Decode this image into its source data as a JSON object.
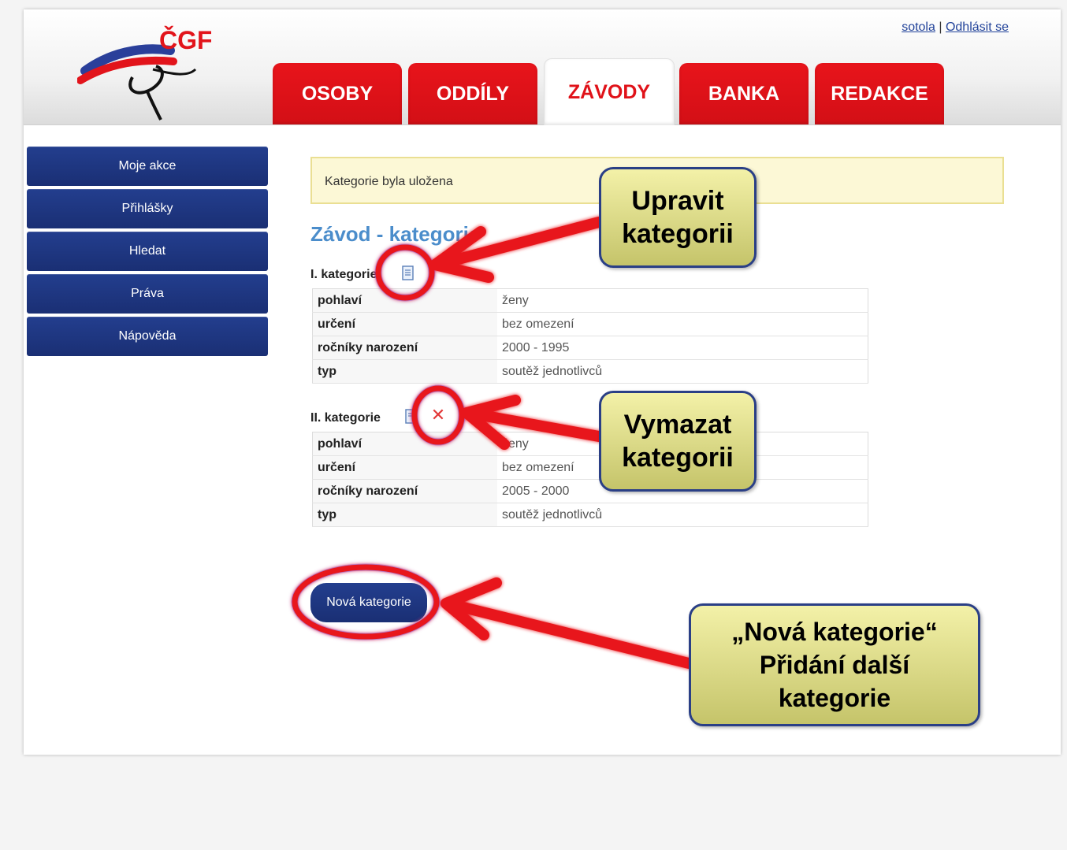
{
  "header": {
    "logo_text": "ČGF",
    "user": "sotola",
    "separator": "|",
    "logout": "Odhlásit se",
    "tabs": [
      {
        "label": "OSOBY",
        "active": false
      },
      {
        "label": "ODDÍLY",
        "active": false
      },
      {
        "label": "ZÁVODY",
        "active": true
      },
      {
        "label": "BANKA",
        "active": false
      },
      {
        "label": "REDAKCE",
        "active": false
      }
    ]
  },
  "sidebar": {
    "items": [
      {
        "label": "Moje akce"
      },
      {
        "label": "Přihlášky"
      },
      {
        "label": "Hledat"
      },
      {
        "label": "Práva"
      },
      {
        "label": "Nápověda"
      }
    ]
  },
  "main": {
    "notice": "Kategorie byla uložena",
    "title": "Závod - kategorie",
    "categories": [
      {
        "heading": "I. kategorie",
        "rows": [
          {
            "label": "pohlaví",
            "value": "ženy"
          },
          {
            "label": "určení",
            "value": "bez omezení"
          },
          {
            "label": "ročníky narození",
            "value": "2000 - 1995"
          },
          {
            "label": "typ",
            "value": "soutěž jednotlivců"
          }
        ]
      },
      {
        "heading": "II. kategorie",
        "rows": [
          {
            "label": "pohlaví",
            "value": "ženy"
          },
          {
            "label": "určení",
            "value": "bez omezení"
          },
          {
            "label": "ročníky narození",
            "value": "2005 - 2000"
          },
          {
            "label": "typ",
            "value": "soutěž jednotlivců"
          }
        ]
      }
    ],
    "new_button": "Nová kategorie"
  },
  "annotations": {
    "edit_callout": [
      "Upravit",
      "kategorii"
    ],
    "delete_callout": [
      "Vymazat",
      "kategorii"
    ],
    "new_callout": [
      "„Nová kategorie“",
      "Přidání další",
      "kategorie"
    ]
  },
  "colors": {
    "tab_red": "#e0131a",
    "nav_blue": "#1f3782",
    "title_blue": "#4b8dcb",
    "annotation_red": "#e8141b",
    "callout_yellow": "#e6e48e"
  }
}
